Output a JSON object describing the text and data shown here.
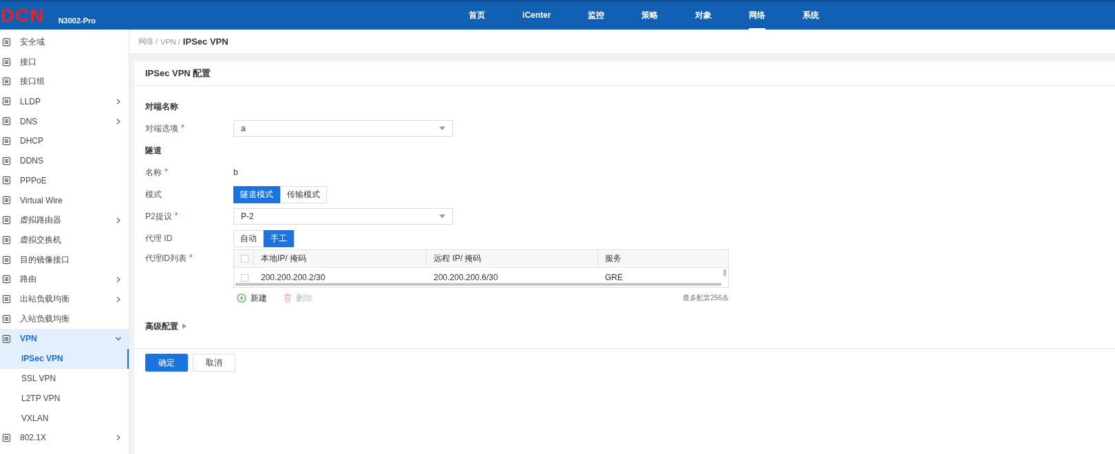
{
  "header": {
    "logo": "DCN",
    "model": "N3002-Pro",
    "nav": [
      {
        "label": "首页",
        "selected": false
      },
      {
        "label": "iCenter",
        "selected": false
      },
      {
        "label": "监控",
        "selected": false
      },
      {
        "label": "策略",
        "selected": false
      },
      {
        "label": "对象",
        "selected": false
      },
      {
        "label": "网络",
        "selected": true
      },
      {
        "label": "系统",
        "selected": false
      }
    ]
  },
  "sidebar": {
    "items": [
      {
        "label": "安全域",
        "has_arrow": false
      },
      {
        "label": "接口",
        "has_arrow": false
      },
      {
        "label": "接口组",
        "has_arrow": false
      },
      {
        "label": "LLDP",
        "has_arrow": true
      },
      {
        "label": "DNS",
        "has_arrow": true
      },
      {
        "label": "DHCP",
        "has_arrow": false
      },
      {
        "label": "DDNS",
        "has_arrow": false
      },
      {
        "label": "PPPoE",
        "has_arrow": false
      },
      {
        "label": "Virtual Wire",
        "has_arrow": false
      },
      {
        "label": "虚拟路由器",
        "has_arrow": true
      },
      {
        "label": "虚拟交换机",
        "has_arrow": false
      },
      {
        "label": "目的镜像接口",
        "has_arrow": false
      },
      {
        "label": "路由",
        "has_arrow": true
      },
      {
        "label": "出站负载均衡",
        "has_arrow": true
      },
      {
        "label": "入站负载均衡",
        "has_arrow": false
      },
      {
        "label": "VPN",
        "has_arrow": true,
        "expanded": true,
        "children": [
          {
            "label": "IPSec VPN",
            "selected": true
          },
          {
            "label": "SSL VPN",
            "selected": false
          },
          {
            "label": "L2TP VPN",
            "selected": false
          },
          {
            "label": "VXLAN",
            "selected": false
          }
        ]
      },
      {
        "label": "802.1X",
        "has_arrow": true
      }
    ]
  },
  "breadcrumb": [
    "网络 /",
    "VPN /",
    "IPSec VPN"
  ],
  "card": {
    "title": "IPSec VPN 配置",
    "rows": [
      {
        "kind": "section",
        "label": "对端名称"
      },
      {
        "kind": "select",
        "label": "对端选项",
        "required_mark": "*",
        "value": "a"
      },
      {
        "kind": "section",
        "label": "隧道"
      },
      {
        "kind": "text",
        "label": "名称",
        "required_mark": "*",
        "value": "b"
      },
      {
        "kind": "segmented",
        "label": "模式",
        "options": [
          {
            "label": "隧道模式",
            "selected": true
          },
          {
            "label": "传输模式",
            "selected": false
          }
        ]
      },
      {
        "kind": "select",
        "label": "P2提议",
        "required_mark": "*",
        "value": "P-2"
      },
      {
        "kind": "segmented",
        "label": "代理 ID",
        "options": [
          {
            "label": "自动",
            "selected": false
          },
          {
            "label": "手工",
            "selected": true
          }
        ]
      },
      {
        "kind": "table",
        "label": "代理ID列表",
        "required_mark": "*",
        "all_checked": false,
        "columns": [
          "本地IP/ 掩码",
          "远程 IP/ 掩码",
          "服务"
        ],
        "rows": [
          {
            "checked": false,
            "cells": [
              "200.200.200.2/30",
              "200.200.200.6/30",
              "GRE"
            ]
          }
        ],
        "add": "新建",
        "delete": "删除",
        "delete_disabled": true,
        "note": "最多配置256条"
      },
      {
        "kind": "collapsed",
        "label": "高级配置"
      }
    ],
    "buttons": [
      {
        "label": "确定",
        "primary": true
      },
      {
        "label": "取消",
        "primary": false
      }
    ]
  }
}
